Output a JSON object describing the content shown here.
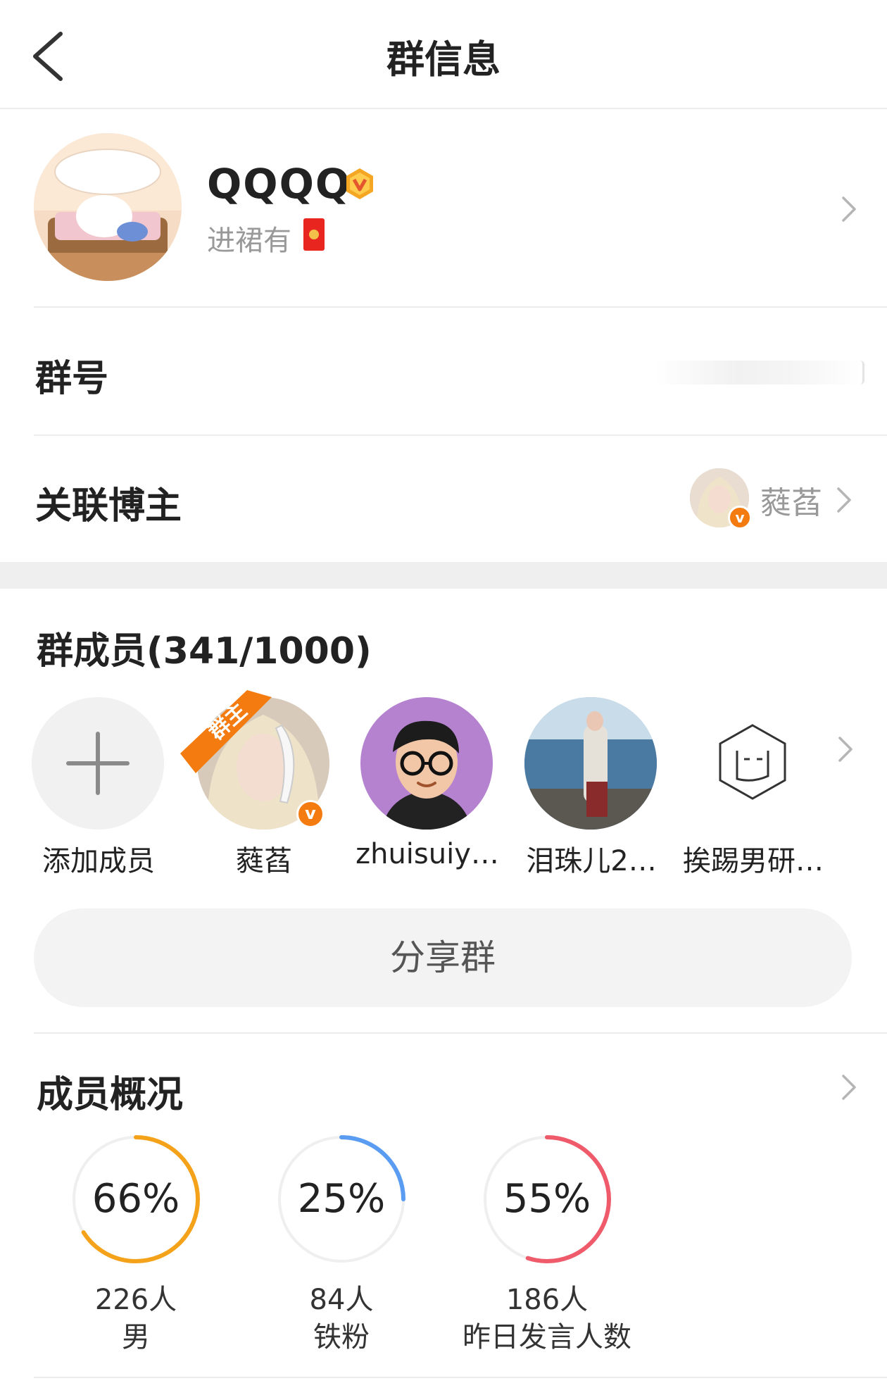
{
  "header": {
    "title": "群信息",
    "back_icon": "chevron-left-icon"
  },
  "group": {
    "name": "QQQQ",
    "sub": "进裙有",
    "badge_icon": "vip-badge-icon",
    "badge_color": "#f5a623",
    "redpack_icon": "red-envelope-icon"
  },
  "group_number": {
    "label": "群号"
  },
  "blogger": {
    "label": "关联博主",
    "name": "蕤萏"
  },
  "members": {
    "title": "群成员(341/1000)",
    "owner_tag": "群主",
    "items": [
      {
        "name": "添加成员",
        "icon": "plus-icon"
      },
      {
        "name": "蕤萏"
      },
      {
        "name": "zhuisuiy…"
      },
      {
        "name": "泪珠儿2…"
      },
      {
        "name": "挨踢男研…"
      }
    ]
  },
  "share": {
    "label": "分享群"
  },
  "overview": {
    "title": "成员概况",
    "stats": [
      {
        "pct": "66%",
        "value": 0.66,
        "count": "226人",
        "label": "男",
        "color": "#f5a21b"
      },
      {
        "pct": "25%",
        "value": 0.25,
        "count": "84人",
        "label": "铁粉",
        "color": "#5a9cf2"
      },
      {
        "pct": "55%",
        "value": 0.55,
        "count": "186人",
        "label": "昨日发言人数",
        "color": "#ef5b6a"
      }
    ]
  }
}
